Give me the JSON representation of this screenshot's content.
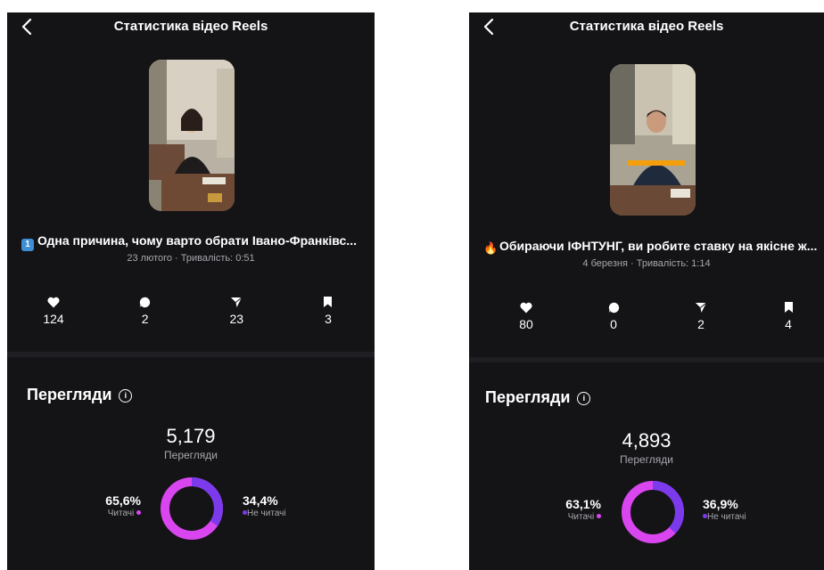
{
  "colors": {
    "panel_bg": "#141417",
    "followers": "#d946ef",
    "non_followers": "#7c3aed"
  },
  "left": {
    "title": "Статистика відео Reels",
    "caption_emoji": "1",
    "caption": "Одна причина, чому варто обрати Івано-Франківс...",
    "meta": "23 лютого · Тривалість: 0:51",
    "stats": {
      "likes": "124",
      "comments": "2",
      "shares": "23",
      "saves": "3"
    },
    "views_title": "Перегляди",
    "views_total": "5,179",
    "views_label": "Перегляди",
    "followers_pct": "65,6%",
    "followers_label": "Читачі",
    "non_followers_pct": "34,4%",
    "non_followers_label": "Не читачі",
    "followers_share": 0.656
  },
  "right": {
    "title": "Статистика відео Reels",
    "caption_emoji": "🔥",
    "caption": "Обираючи ІФНТУНГ, ви робите ставку на якісне ж...",
    "meta": "4 березня · Тривалість: 1:14",
    "stats": {
      "likes": "80",
      "comments": "0",
      "shares": "2",
      "saves": "4"
    },
    "views_title": "Перегляди",
    "views_total": "4,893",
    "views_label": "Перегляди",
    "followers_pct": "63,1%",
    "followers_label": "Читачі",
    "non_followers_pct": "36,9%",
    "non_followers_label": "Не читачі",
    "followers_share": 0.631
  }
}
